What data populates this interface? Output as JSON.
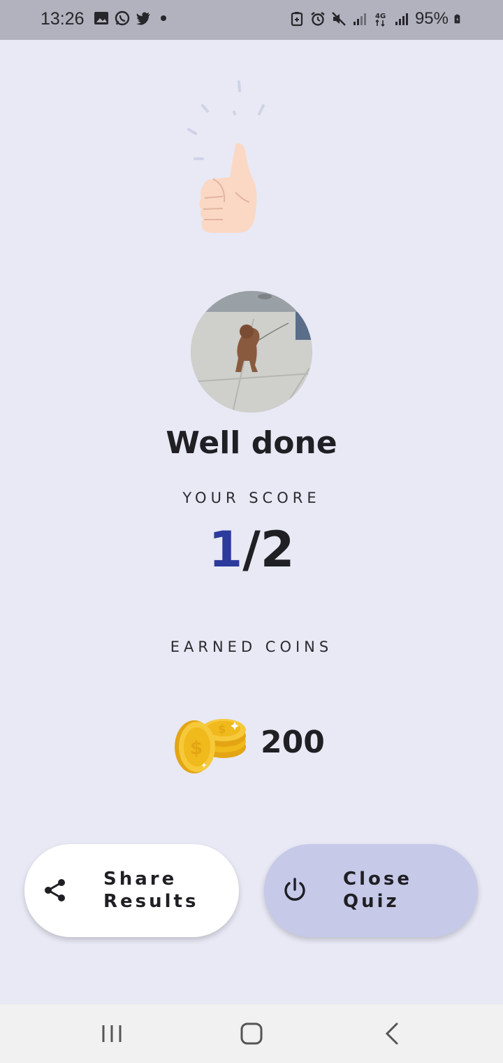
{
  "status_bar": {
    "time": "13:26",
    "battery": "95%",
    "left_icons": [
      "gallery-icon",
      "whatsapp-icon",
      "twitter-icon",
      "notification-dot"
    ],
    "right_icons": [
      "battery-saver-icon",
      "alarm-icon",
      "mute-icon",
      "signal-icon",
      "4g-icon",
      "signal-icon",
      "battery-icon"
    ]
  },
  "result": {
    "title": "Well done",
    "score_label": "YOUR SCORE",
    "score_got": "1",
    "score_total": "/2",
    "coins_label": "EARNED COINS",
    "coins_amount": "200"
  },
  "actions": {
    "share_label": "Share\nResults",
    "share_line1": "Share",
    "share_line2": "Results",
    "close_line1": "Close",
    "close_line2": "Quiz"
  },
  "colors": {
    "background": "#e8e9f5",
    "score_accent": "#2c3a9e",
    "close_button": "#c6c9e8",
    "share_button": "#ffffff"
  },
  "nav": {
    "icons": [
      "recent-apps-icon",
      "home-icon",
      "back-icon"
    ]
  }
}
